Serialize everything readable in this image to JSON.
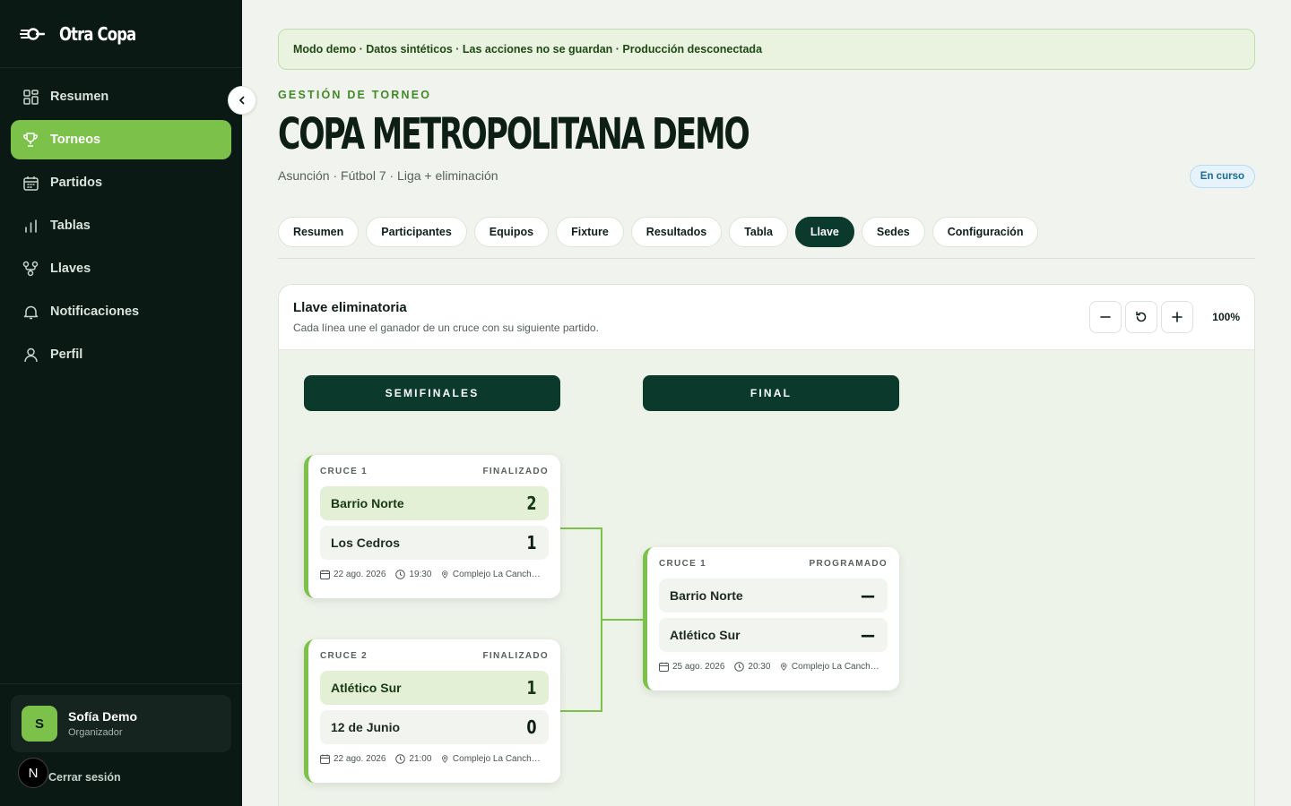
{
  "app": {
    "name": "Otra Copa"
  },
  "sidebar": {
    "items": [
      {
        "label": "Resumen",
        "icon": "grid-icon"
      },
      {
        "label": "Torneos",
        "icon": "trophy-icon",
        "active": true
      },
      {
        "label": "Partidos",
        "icon": "calendar-icon"
      },
      {
        "label": "Tablas",
        "icon": "bar-chart-icon"
      },
      {
        "label": "Llaves",
        "icon": "bracket-icon"
      },
      {
        "label": "Notificaciones",
        "icon": "bell-icon"
      },
      {
        "label": "Perfil",
        "icon": "user-icon"
      }
    ],
    "user": {
      "initial": "S",
      "name": "Sofía Demo",
      "role": "Organizador"
    },
    "logout": "Cerrar sesión",
    "badge": "N"
  },
  "banner": "Modo demo · Datos sintéticos · Las acciones no se guardan · Producción desconectada",
  "header": {
    "eyebrow": "GESTIÓN DE TORNEO",
    "title": "COPA METROPOLITANA DEMO",
    "subtitle": "Asunción · Fútbol 7 · Liga + eliminación",
    "status": "En curso"
  },
  "tabs": [
    "Resumen",
    "Participantes",
    "Equipos",
    "Fixture",
    "Resultados",
    "Tabla",
    "Llave",
    "Sedes",
    "Configuración"
  ],
  "active_tab": "Llave",
  "bracket": {
    "title": "Llave eliminatoria",
    "description": "Cada línea une el ganador de un cruce con su siguiente partido.",
    "zoom": "100%",
    "rounds": [
      "SEMIFINALES",
      "FINAL"
    ],
    "matches": [
      {
        "label": "CRUCE 1",
        "status": "FINALIZADO",
        "team1": {
          "name": "Barrio Norte",
          "score": "2",
          "winner": true
        },
        "team2": {
          "name": "Los Cedros",
          "score": "1",
          "winner": false
        },
        "date": "22 ago. 2026",
        "time": "19:30",
        "venue": "Complejo La Cancha Central"
      },
      {
        "label": "CRUCE 2",
        "status": "FINALIZADO",
        "team1": {
          "name": "Atlético Sur",
          "score": "1",
          "winner": true
        },
        "team2": {
          "name": "12 de Junio",
          "score": "0",
          "winner": false
        },
        "date": "22 ago. 2026",
        "time": "21:00",
        "venue": "Complejo La Cancha Central"
      },
      {
        "label": "CRUCE 1",
        "status": "PROGRAMADO",
        "team1": {
          "name": "Barrio Norte",
          "score": "—",
          "winner": false
        },
        "team2": {
          "name": "Atlético Sur",
          "score": "—",
          "winner": false
        },
        "date": "25 ago. 2026",
        "time": "20:30",
        "venue": "Complejo La Cancha Central"
      }
    ]
  },
  "colors": {
    "accent": "#7cc24a",
    "dark": "#0a1914",
    "primary": "#0b3a2c"
  }
}
